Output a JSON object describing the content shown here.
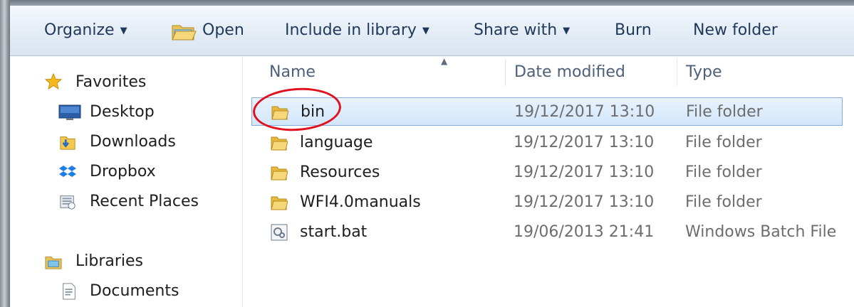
{
  "toolbar": {
    "organize": "Organize",
    "open": "Open",
    "include_in_library": "Include in library",
    "share_with": "Share with",
    "burn": "Burn",
    "new_folder": "New folder"
  },
  "nav": {
    "favorites": "Favorites",
    "items": [
      "Desktop",
      "Downloads",
      "Dropbox",
      "Recent Places"
    ],
    "libraries": "Libraries",
    "library_items": [
      "Documents"
    ]
  },
  "columns": {
    "name": "Name",
    "date_modified": "Date modified",
    "type": "Type"
  },
  "files": [
    {
      "name": "bin",
      "date": "19/12/2017 13:10",
      "type": "File folder",
      "icon": "folder-icon",
      "selected": true
    },
    {
      "name": "language",
      "date": "19/12/2017 13:10",
      "type": "File folder",
      "icon": "folder-icon"
    },
    {
      "name": "Resources",
      "date": "19/12/2017 13:10",
      "type": "File folder",
      "icon": "folder-icon"
    },
    {
      "name": "WFI4.0manuals",
      "date": "19/12/2017 13:10",
      "type": "File folder",
      "icon": "folder-icon"
    },
    {
      "name": "start.bat",
      "date": "19/06/2013 21:41",
      "type": "Windows Batch File",
      "icon": "batch-file-icon"
    }
  ],
  "colors": {
    "selection_border": "#84acdd",
    "selection_fill": "#d2e6fa",
    "highlight_circle": "#e0121f",
    "folder_yellow": "#f2c94c"
  }
}
